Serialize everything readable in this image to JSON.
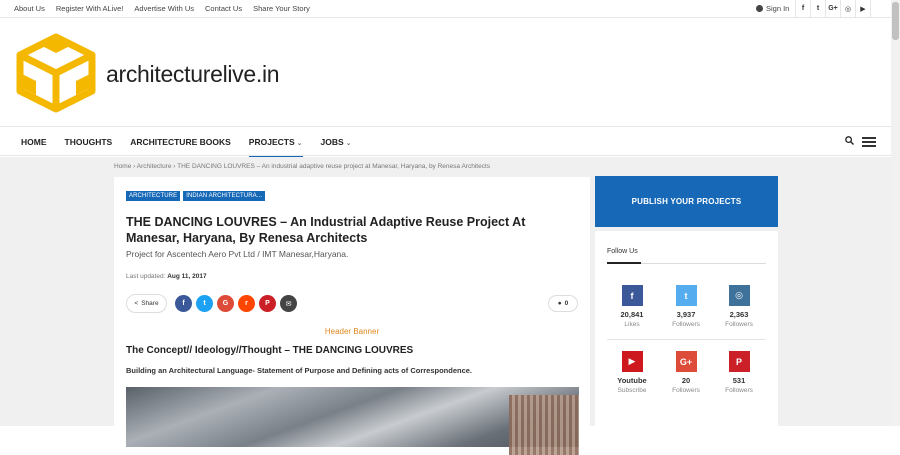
{
  "topbar": {
    "links": [
      "About Us",
      "Register With ALive!",
      "Advertise With Us",
      "Contact Us",
      "Share Your Story"
    ],
    "signin": "Sign In",
    "social": [
      {
        "icon": "facebook-icon",
        "glyph": "f"
      },
      {
        "icon": "twitter-icon",
        "glyph": "t"
      },
      {
        "icon": "googleplus-icon",
        "glyph": "G+"
      },
      {
        "icon": "instagram-icon",
        "glyph": "◎"
      },
      {
        "icon": "youtube-icon",
        "glyph": "▶"
      }
    ]
  },
  "header": {
    "brand": "architecturelive.in",
    "logo_color": "#f5b800"
  },
  "nav": {
    "items": [
      "HOME",
      "THOUGHTS",
      "ARCHITECTURE BOOKS",
      "PROJECTS",
      "JOBS"
    ],
    "active": "PROJECTS",
    "accent": "#1769b8"
  },
  "breadcrumb": {
    "home": "Home",
    "section": "Architecture",
    "current": "THE DANCING LOUVRES – An industrial adaptive reuse project at Manesar, Haryana, by Renesa Architects"
  },
  "article": {
    "categories": [
      "ARCHITECTURE",
      "INDIAN ARCHITECTURA..."
    ],
    "title": "THE DANCING LOUVRES – An Industrial Adaptive Reuse Project At Manesar, Haryana, By Renesa Architects",
    "subtitle": "Project for Ascentech Aero Pvt Ltd / IMT Manesar,Haryana.",
    "updated_label": "Last updated",
    "updated_date": "Aug 11, 2017",
    "share_label": "Share",
    "share_icons": [
      {
        "name": "facebook",
        "color": "#3b5998",
        "glyph": "f"
      },
      {
        "name": "twitter",
        "color": "#1da1f2",
        "glyph": "t"
      },
      {
        "name": "googleplus",
        "color": "#dd4b39",
        "glyph": "G"
      },
      {
        "name": "reddit",
        "color": "#ff4500",
        "glyph": "r"
      },
      {
        "name": "pinterest",
        "color": "#cb2027",
        "glyph": "P"
      },
      {
        "name": "email",
        "color": "#444444",
        "glyph": "✉"
      }
    ],
    "comments": "0",
    "banner": "Header Banner",
    "heading": "The Concept// Ideology//Thought – THE DANCING LOUVRES",
    "lead": "Building an Architectural Language- Statement of Purpose and Defining acts of Correspondence."
  },
  "sidebar": {
    "publish": "PUBLISH YOUR PROJECTS",
    "follow_title": "Follow Us",
    "counters": [
      {
        "icon": "facebook-icon",
        "glyph": "f",
        "color": "#3b5998",
        "count": "20,841",
        "label": "Likes"
      },
      {
        "icon": "twitter-icon",
        "glyph": "t",
        "color": "#55acee",
        "count": "3,937",
        "label": "Followers"
      },
      {
        "icon": "instagram-icon",
        "glyph": "◎",
        "color": "#3f729b",
        "count": "2,363",
        "label": "Followers"
      },
      {
        "icon": "youtube-icon",
        "glyph": "▶",
        "color": "#cc181e",
        "count": "Youtube",
        "label": "Subscribe"
      },
      {
        "icon": "googleplus-icon",
        "glyph": "G+",
        "color": "#dd4b39",
        "count": "20",
        "label": "Followers"
      },
      {
        "icon": "pinterest-icon",
        "glyph": "P",
        "color": "#cb2027",
        "count": "531",
        "label": "Followers"
      }
    ]
  }
}
